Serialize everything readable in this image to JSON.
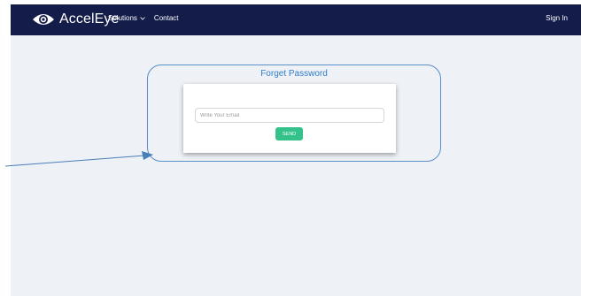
{
  "header": {
    "brand": "AccelEye",
    "nav_items": [
      {
        "label": "Solutions",
        "has_dropdown": true
      },
      {
        "label": "Contact",
        "has_dropdown": false
      }
    ],
    "signin_label": "Sign In"
  },
  "forget_password": {
    "title": "Forget Password",
    "email_placeholder": "Write Your Email",
    "email_value": "",
    "send_label": "SEND"
  },
  "colors": {
    "navbar": "#141c4a",
    "background": "#eef1f6",
    "callout": "#5b8fc7",
    "title": "#2f7ec7",
    "send_button": "#35c28a"
  },
  "icons": {
    "brand": "eye-logo-icon",
    "dropdown": "chevron-down-icon"
  }
}
